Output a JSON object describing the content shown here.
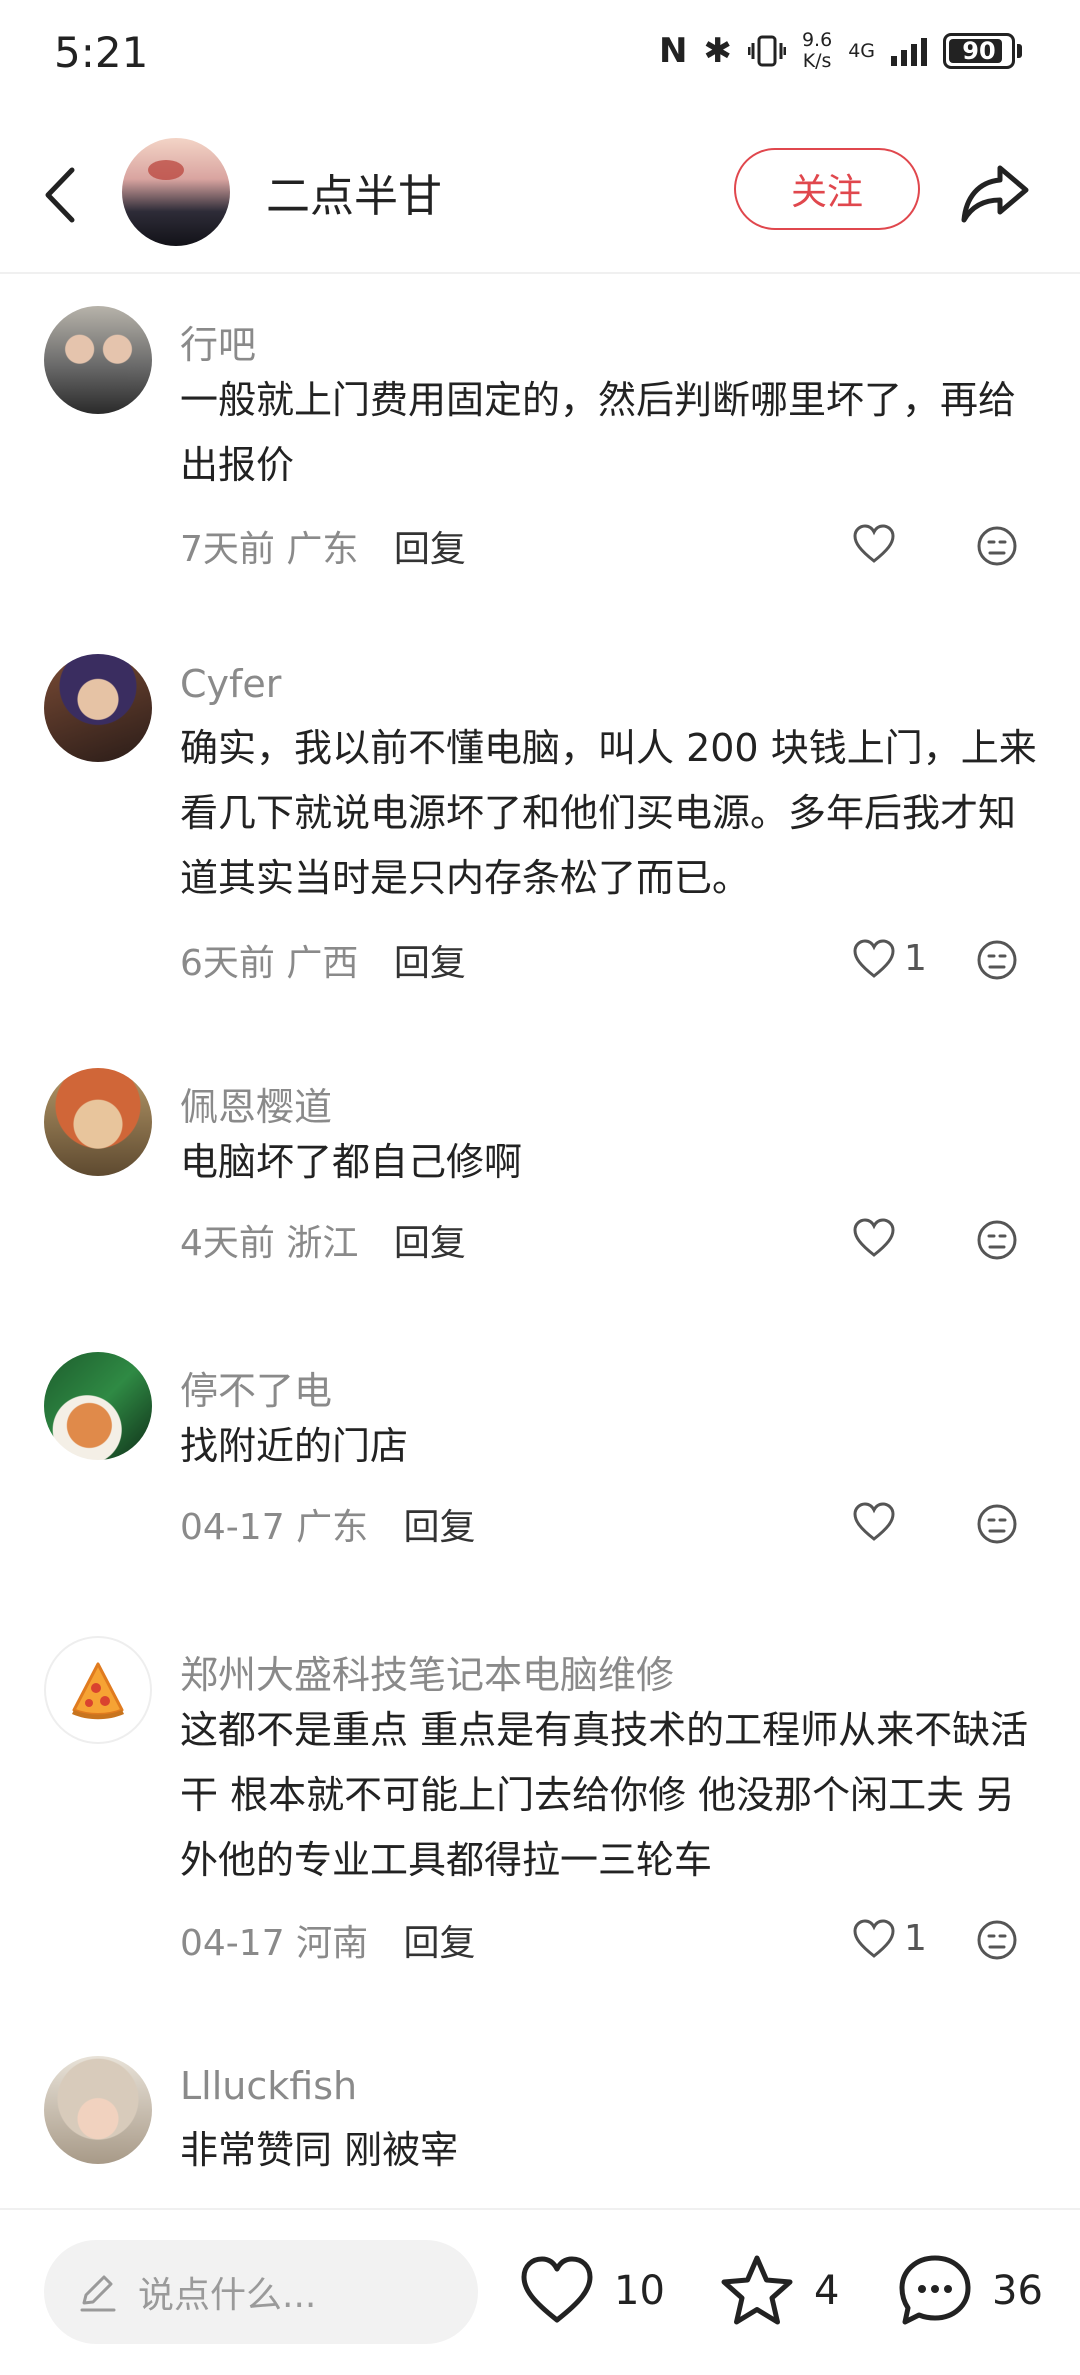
{
  "status_bar": {
    "time": "5:21",
    "nfc_glyph": "N",
    "bt_glyph": "✱",
    "net_speed_value": "9.6",
    "net_speed_unit": "K/s",
    "network": "4G",
    "battery": "90",
    "battery_level": 0.9
  },
  "header": {
    "user_name": "二点半甘",
    "follow_label": "关注"
  },
  "comments": [
    {
      "author": "行吧",
      "text": "一般就上门费用固定的，然后判断哪里坏了，再给出报价",
      "time": "7天前",
      "location": "广东",
      "reply_label": "回复",
      "likes": ""
    },
    {
      "author": "Cyfer",
      "text": "确实，我以前不懂电脑，叫人 200 块钱上门，上来看几下就说电源坏了和他们买电源。多年后我才知道其实当时是只内存条松了而已。",
      "time": "6天前",
      "location": "广西",
      "reply_label": "回复",
      "likes": "1"
    },
    {
      "author": "佩恩樱道",
      "text": "电脑坏了都自己修啊",
      "time": "4天前",
      "location": "浙江",
      "reply_label": "回复",
      "likes": ""
    },
    {
      "author": "停不了电",
      "text": "找附近的门店",
      "time": "04-17",
      "location": "广东",
      "reply_label": "回复",
      "likes": ""
    },
    {
      "author": "郑州大盛科技笔记本电脑维修",
      "text": "这都不是重点 重点是有真技术的工程师从来不缺活干 根本就不可能上门去给你修 他没那个闲工夫  另外他的专业工具都得拉一三轮车",
      "time": "04-17",
      "location": "河南",
      "reply_label": "回复",
      "likes": "1"
    },
    {
      "author": "Llluckfish",
      "text": "非常赞同 刚被宰",
      "time": "",
      "location": "",
      "reply_label": "",
      "likes": ""
    }
  ],
  "bottom_bar": {
    "input_placeholder": "说点什么...",
    "like_count": "10",
    "star_count": "4",
    "comment_count": "36"
  },
  "colors": {
    "accent": "#e0474d",
    "secondary_text": "#8a8a8a",
    "primary_text": "#222222"
  }
}
